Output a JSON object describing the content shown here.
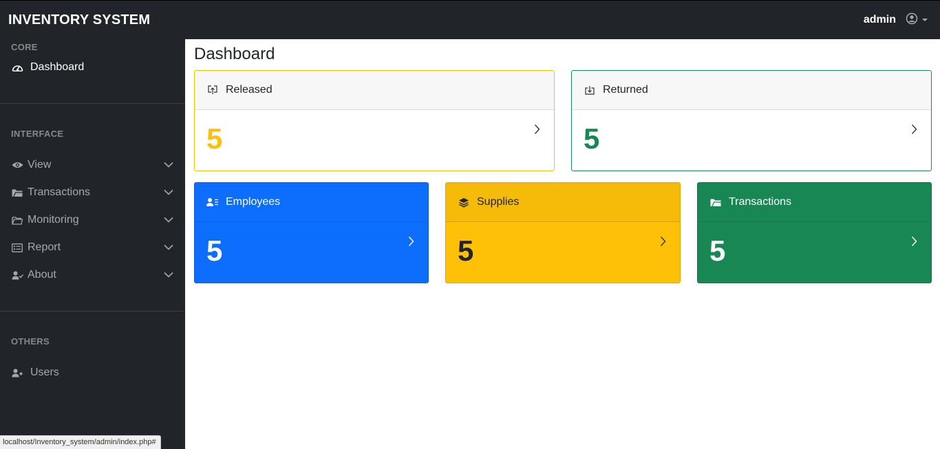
{
  "topbar": {
    "brand": "INVENTORY SYSTEM",
    "username": "admin",
    "user_icon": "user-circle-icon"
  },
  "sidebar": {
    "headings": {
      "core": "CORE",
      "interface": "INTERFACE",
      "others": "OTHERS"
    },
    "items": [
      {
        "label": "Dashboard",
        "icon": "tachometer-icon",
        "active": true
      },
      {
        "label": "View",
        "icon": "eye-icon",
        "expandable": true
      },
      {
        "label": "Transactions",
        "icon": "folder-open-icon",
        "expandable": true
      },
      {
        "label": "Monitoring",
        "icon": "folder-outline-icon",
        "expandable": true
      },
      {
        "label": "Report",
        "icon": "list-card-icon",
        "expandable": true
      },
      {
        "label": "About",
        "icon": "user-check-icon",
        "expandable": true
      },
      {
        "label": "Users",
        "icon": "user-plus-icon"
      }
    ]
  },
  "main": {
    "title": "Dashboard",
    "cards": [
      {
        "id": "released",
        "label": "Released",
        "value": "5",
        "icon": "upload-box-icon",
        "accent": "#ffc107"
      },
      {
        "id": "returned",
        "label": "Returned",
        "value": "5",
        "icon": "download-box-icon",
        "accent": "#198754"
      },
      {
        "id": "employees",
        "label": "Employees",
        "value": "5",
        "icon": "user-list-icon",
        "accent": "#0d6efd"
      },
      {
        "id": "supplies",
        "label": "Supplies",
        "value": "5",
        "icon": "layers-icon",
        "accent": "#ffc107"
      },
      {
        "id": "transactions",
        "label": "Transactions",
        "value": "5",
        "icon": "folder-open-icon",
        "accent": "#198754"
      }
    ]
  },
  "statusbar": {
    "url": "localhost/Inventory_system/admin/index.php#"
  },
  "colors": {
    "sidebar_bg": "#212529",
    "primary": "#0d6efd",
    "warning": "#ffc107",
    "success": "#198754"
  }
}
